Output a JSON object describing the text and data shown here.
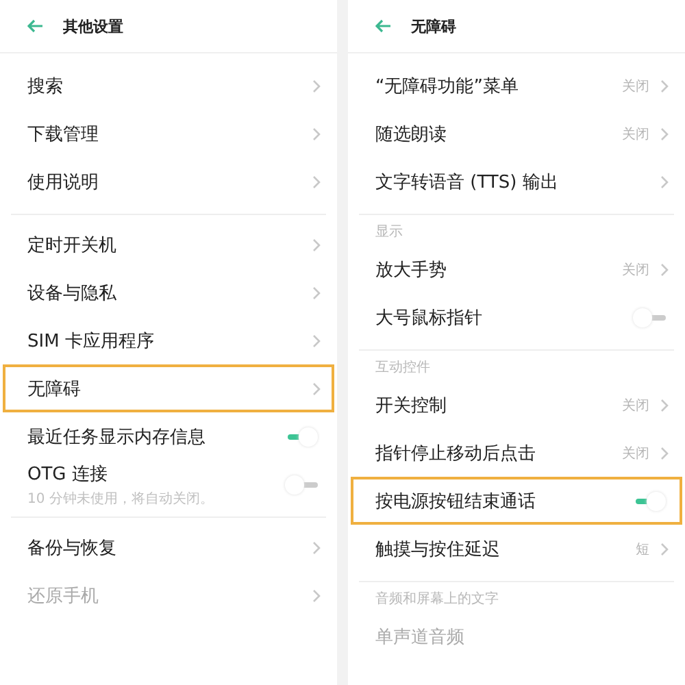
{
  "panels": [
    {
      "title": "其他设置",
      "groups": [
        {
          "items": [
            {
              "kind": "nav",
              "label": "搜索",
              "disabled": false,
              "highlighted": false
            },
            {
              "kind": "nav",
              "label": "下载管理",
              "disabled": false,
              "highlighted": false
            },
            {
              "kind": "nav",
              "label": "使用说明",
              "disabled": false,
              "highlighted": false
            }
          ]
        },
        {
          "items": [
            {
              "kind": "nav",
              "label": "定时开关机",
              "disabled": false,
              "highlighted": false
            },
            {
              "kind": "nav",
              "label": "设备与隐私",
              "disabled": false,
              "highlighted": false
            },
            {
              "kind": "nav",
              "label": "SIM 卡应用程序",
              "disabled": false,
              "highlighted": false
            },
            {
              "kind": "nav",
              "label": "无障碍",
              "disabled": false,
              "highlighted": true
            },
            {
              "kind": "toggle",
              "label": "最近任务显示内存信息",
              "on": true,
              "disabled": false,
              "highlighted": false
            },
            {
              "kind": "toggle",
              "label": "OTG 连接",
              "subtitle": "10 分钟未使用，将自动关闭。",
              "on": false,
              "disabled": false,
              "highlighted": false
            }
          ]
        },
        {
          "items": [
            {
              "kind": "nav",
              "label": "备份与恢复",
              "disabled": false,
              "highlighted": false
            },
            {
              "kind": "nav",
              "label": "还原手机",
              "disabled": true,
              "highlighted": false
            }
          ]
        }
      ]
    },
    {
      "title": "无障碍",
      "groups": [
        {
          "items": [
            {
              "kind": "nav",
              "label": "“无障碍功能”菜单",
              "value": "关闭",
              "disabled": false,
              "highlighted": false
            },
            {
              "kind": "nav",
              "label": "随选朗读",
              "value": "关闭",
              "disabled": false,
              "highlighted": false
            },
            {
              "kind": "nav",
              "label": "文字转语音 (TTS) 输出",
              "disabled": false,
              "highlighted": false
            }
          ]
        },
        {
          "section": "显示",
          "items": [
            {
              "kind": "nav",
              "label": "放大手势",
              "value": "关闭",
              "disabled": false,
              "highlighted": false
            },
            {
              "kind": "toggle",
              "label": "大号鼠标指针",
              "on": false,
              "disabled": false,
              "highlighted": false
            }
          ]
        },
        {
          "section": "互动控件",
          "items": [
            {
              "kind": "nav",
              "label": "开关控制",
              "value": "关闭",
              "disabled": false,
              "highlighted": false
            },
            {
              "kind": "nav",
              "label": "指针停止移动后点击",
              "value": "关闭",
              "disabled": false,
              "highlighted": false
            },
            {
              "kind": "toggle",
              "label": "按电源按钮结束通话",
              "on": true,
              "disabled": false,
              "highlighted": true
            },
            {
              "kind": "nav",
              "label": "触摸与按住延迟",
              "value": "短",
              "disabled": false,
              "highlighted": false
            }
          ]
        },
        {
          "section": "音频和屏幕上的文字",
          "items": [
            {
              "kind": "text",
              "label": "单声道音频",
              "disabled": true,
              "highlighted": false
            }
          ]
        }
      ]
    }
  ]
}
